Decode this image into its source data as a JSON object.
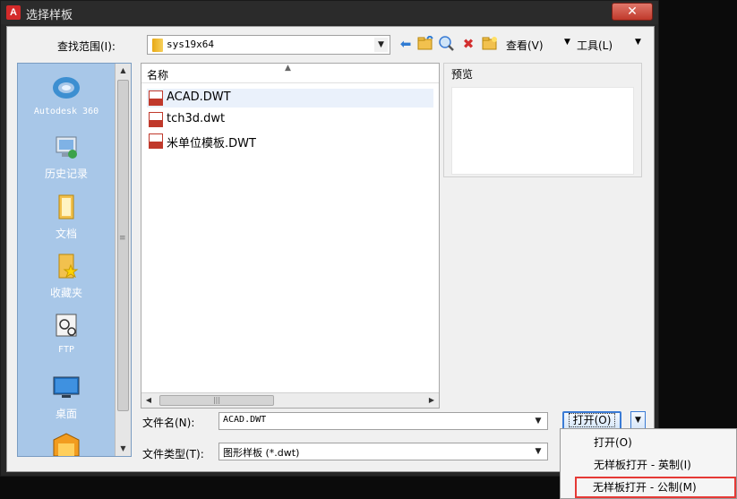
{
  "window": {
    "title": "选择样板",
    "close_glyph": "✕",
    "app_icon": "A"
  },
  "toolbar": {
    "lookin_label": "查找范围(I):",
    "lookin_value": "sys19x64",
    "view_label": "查看(V)",
    "tools_label": "工具(L)",
    "icons": [
      "back-arrow-icon",
      "up-folder-icon",
      "search-web-icon",
      "delete-icon",
      "new-folder-icon"
    ]
  },
  "sidebar": {
    "items": [
      {
        "label": "Autodesk 360",
        "icon": "cloud-icon"
      },
      {
        "label": "历史记录",
        "icon": "history-icon"
      },
      {
        "label": "文档",
        "icon": "documents-icon"
      },
      {
        "label": "收藏夹",
        "icon": "favorites-icon"
      },
      {
        "label": "FTP",
        "icon": "ftp-icon"
      },
      {
        "label": "桌面",
        "icon": "desktop-icon"
      }
    ]
  },
  "filelist": {
    "column_name": "名称",
    "files": [
      {
        "name": "ACAD.DWT"
      },
      {
        "name": "tch3d.dwt"
      },
      {
        "name": "米单位模板.DWT"
      }
    ]
  },
  "preview": {
    "label": "预览"
  },
  "filename": {
    "label": "文件名(N):",
    "value": "ACAD.DWT"
  },
  "filetype": {
    "label": "文件类型(T):",
    "value": "图形样板 (*.dwt)"
  },
  "open_button": {
    "label": "打开(O)"
  },
  "dropdown_menu": {
    "items": [
      {
        "label": "打开(O)"
      },
      {
        "label": "无样板打开 - 英制(I)"
      },
      {
        "label": "无样板打开 - 公制(M)"
      }
    ]
  }
}
